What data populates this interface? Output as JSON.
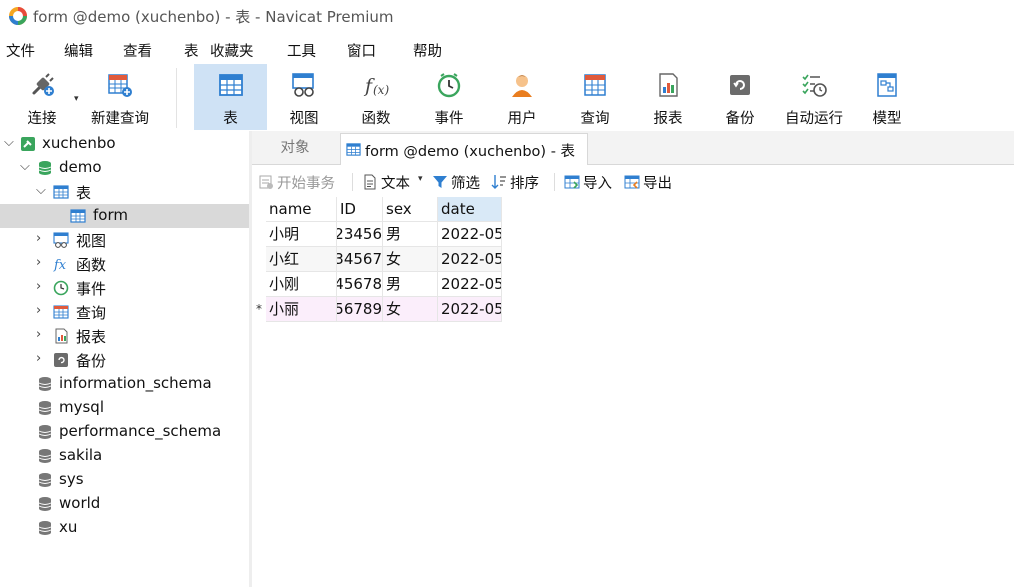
{
  "window": {
    "title": "form @demo (xuchenbo) - 表 - Navicat Premium"
  },
  "menubar": [
    "文件",
    "编辑",
    "查看",
    "表",
    "收藏夹",
    "工具",
    "窗口",
    "帮助"
  ],
  "toolbar": {
    "connect": "连接",
    "new_query": "新建查询",
    "table": "表",
    "view": "视图",
    "function": "函数",
    "event": "事件",
    "user": "用户",
    "query": "查询",
    "report": "报表",
    "backup": "备份",
    "auto_run": "自动运行",
    "model": "模型"
  },
  "sidebar": {
    "connection": "xuchenbo",
    "database": "demo",
    "tables_label": "表",
    "table_form": "form",
    "views": "视图",
    "functions": "函数",
    "events": "事件",
    "queries": "查询",
    "reports": "报表",
    "backups": "备份",
    "databases": [
      "information_schema",
      "mysql",
      "performance_schema",
      "sakila",
      "sys",
      "world",
      "xu"
    ]
  },
  "tabs": {
    "objects": "对象",
    "active": "form @demo (xuchenbo) - 表"
  },
  "subtoolbar": {
    "begin_transaction": "开始事务",
    "text": "文本",
    "filter": "筛选",
    "sort": "排序",
    "import": "导入",
    "export": "导出"
  },
  "grid": {
    "columns": [
      "name",
      "ID",
      "sex",
      "date"
    ],
    "rows": [
      [
        "小明",
        "23456",
        "男",
        "2022-05"
      ],
      [
        "小红",
        "34567",
        "女",
        "2022-05"
      ],
      [
        "小刚",
        "45678",
        "男",
        "2022-05"
      ],
      [
        "小丽",
        "56789",
        "女",
        "2022-05"
      ]
    ],
    "current_row_marker": "*"
  },
  "colors": {
    "accent": "#2f7fd0",
    "active_tool_bg": "#cfe2f5",
    "selected_tree_bg": "#d9d9d9",
    "current_row_bg": "#fbeefb",
    "sorted_header_bg": "#d9e9f7"
  }
}
